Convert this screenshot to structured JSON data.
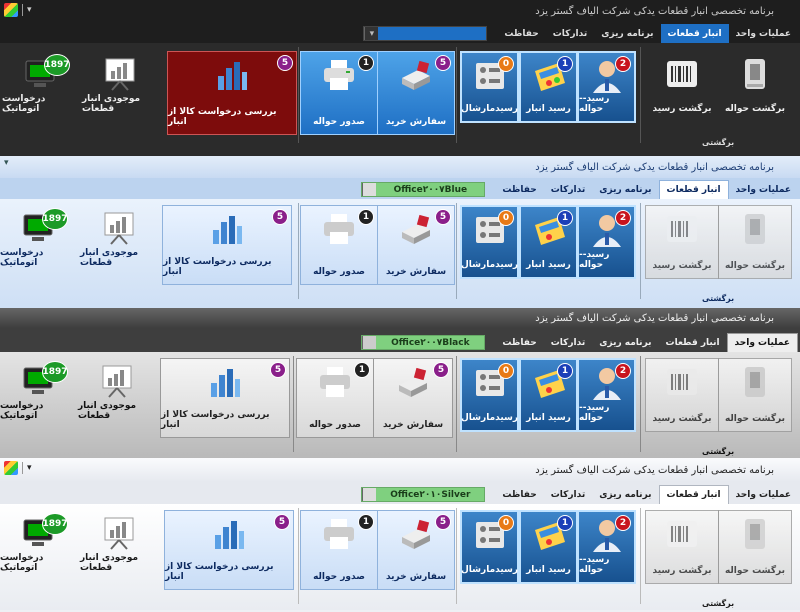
{
  "app_title": "برنامه تخصصی انبار قطعات یدکی شرکت الیاف گستر یزد",
  "tabs": [
    "عملیات واحد",
    "انبار قطعات",
    "برنامه ریزی",
    "تدارکات",
    "حفاظت"
  ],
  "group_label": "برگشتی",
  "themes": [
    {
      "style_name": "",
      "active_tab": "انبار قطعات"
    },
    {
      "style_name": "Office۲۰۰۷Blue",
      "active_tab": "انبار قطعات"
    },
    {
      "style_name": "Office۲۰۰۷Black",
      "active_tab": "عملیات واحد"
    },
    {
      "style_name": "Office۲۰۱۰Silver",
      "active_tab": "انبار قطعات"
    }
  ],
  "buttons": {
    "return_issue": "برگشت حواله",
    "return_receipt": "برگشت رسید",
    "receipt_issue": "رسید-- حواله",
    "warehouse_receipt": "رسید انبار",
    "marshal_receipt": "رسیدمارشال",
    "purchase_order": "سفارش خرید",
    "issue_note": "صدور حواله",
    "review_request": "بررسی درخواست کالا از انبار",
    "parts_inventory": "موجودی انبار قطعات",
    "auto_request": "درخواست اتوماتیک"
  },
  "badges": {
    "receipt_issue": "2",
    "warehouse_receipt": "1",
    "marshal_receipt": "0",
    "purchase_order": "5",
    "issue_note": "1",
    "review_request": "5",
    "auto_request": "1897"
  },
  "colors": {
    "dark_bg": "#2b2b2b",
    "blue_bg": "#cfe0f5",
    "black_bg": "#545454",
    "silver_bg": "#eef0f4",
    "accent_blue": "#1e6fc4",
    "maroon": "#7d0c0c"
  },
  "icons": [
    "return-issue-icon",
    "barcode-icon",
    "person-icon",
    "calculator-icon",
    "switch-panel-icon",
    "cash-register-icon",
    "printer-icon",
    "bar-chart-icon",
    "presentation-icon",
    "monitor-icon"
  ]
}
